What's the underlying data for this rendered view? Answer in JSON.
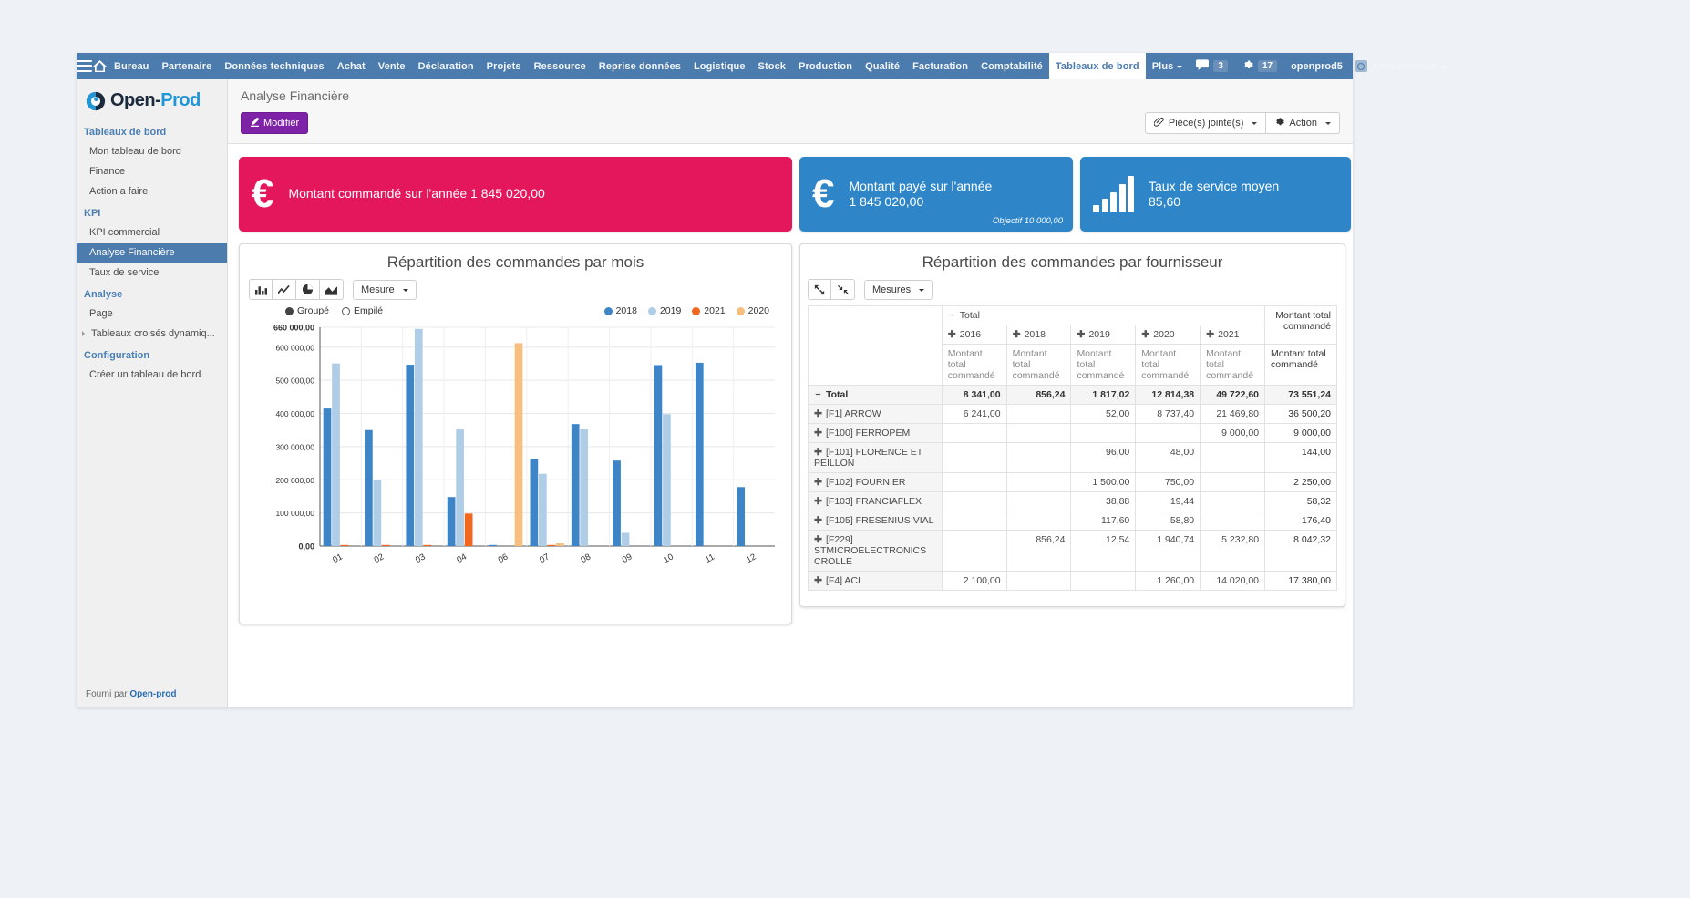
{
  "navbar": {
    "burger_icon": "hamburger-menu-icon",
    "home_icon": "home-icon",
    "items": [
      {
        "label": "Bureau",
        "active": false
      },
      {
        "label": "Partenaire",
        "active": false
      },
      {
        "label": "Données techniques",
        "active": false
      },
      {
        "label": "Achat",
        "active": false
      },
      {
        "label": "Vente",
        "active": false
      },
      {
        "label": "Déclaration",
        "active": false
      },
      {
        "label": "Projets",
        "active": false
      },
      {
        "label": "Ressource",
        "active": false
      },
      {
        "label": "Reprise données",
        "active": false
      },
      {
        "label": "Logistique",
        "active": false
      },
      {
        "label": "Stock",
        "active": false
      },
      {
        "label": "Production",
        "active": false
      },
      {
        "label": "Qualité",
        "active": false
      },
      {
        "label": "Facturation",
        "active": false
      },
      {
        "label": "Comptabilité",
        "active": false
      },
      {
        "label": "Tableaux de bord",
        "active": true
      },
      {
        "label": "Plus",
        "active": false,
        "caret": true
      }
    ],
    "messages_count": "3",
    "activities_count": "17",
    "database": "openprod5",
    "user": "Administrator"
  },
  "sidebar": {
    "brand": {
      "open": "Open",
      "dash": "-",
      "prod": "Prod"
    },
    "groups": [
      {
        "title": "Tableaux de bord",
        "items": [
          {
            "label": "Mon tableau de bord",
            "active": false,
            "expandable": false
          },
          {
            "label": "Finance",
            "active": false,
            "expandable": false
          },
          {
            "label": "Action a faire",
            "active": false,
            "expandable": false
          }
        ]
      },
      {
        "title": "KPI",
        "items": [
          {
            "label": "KPI commercial",
            "active": false,
            "expandable": false
          },
          {
            "label": "Analyse Financière",
            "active": true,
            "expandable": false
          },
          {
            "label": "Taux de service",
            "active": false,
            "expandable": false
          }
        ]
      },
      {
        "title": "Analyse",
        "items": [
          {
            "label": "Page",
            "active": false,
            "expandable": false
          },
          {
            "label": "Tableaux croisés dynamiq...",
            "active": false,
            "expandable": true
          }
        ]
      },
      {
        "title": "Configuration",
        "items": [
          {
            "label": "Créer un tableau de bord",
            "active": false,
            "expandable": false
          }
        ]
      }
    ],
    "footer_prefix": "Fourni par ",
    "footer_brand": "Open-prod"
  },
  "page": {
    "title": "Analyse Financière",
    "edit_button": "Modifier",
    "edit_icon": "pencil-square-icon",
    "attachments_button": "Pièce(s) jointe(s)",
    "attachments_icon": "paperclip-icon",
    "action_button": "Action",
    "action_icon": "gear-icon"
  },
  "kpis": [
    {
      "name": "montant-commande",
      "icon": "euro-icon",
      "glyph": "€",
      "text": "Montant commandé sur l'année 1 845 020,00",
      "color": "#e4175c",
      "goal": null
    },
    {
      "name": "montant-paye",
      "icon": "euro-icon",
      "glyph": "€",
      "line1": "Montant payé sur l'année",
      "line2": "1 845 020,00",
      "color": "#2e86c8",
      "goal": "Objectif 10 000,00"
    },
    {
      "name": "taux-de-service",
      "icon": "bar-chart-icon",
      "line1": "Taux de service moyen",
      "line2": "85,60",
      "color": "#2e86c8",
      "goal": null
    }
  ],
  "chart_panel": {
    "title": "Répartition des commandes par mois",
    "view_buttons": [
      {
        "name": "bar-chart-icon",
        "label": "bar"
      },
      {
        "name": "line-chart-icon",
        "label": "line"
      },
      {
        "name": "pie-chart-icon",
        "label": "pie"
      },
      {
        "name": "area-chart-icon",
        "label": "area"
      }
    ],
    "measure_dropdown": "Mesure",
    "mode_options": [
      {
        "label": "Groupé",
        "selected": true
      },
      {
        "label": "Empilé",
        "selected": false
      }
    ]
  },
  "chart_data": {
    "type": "bar",
    "title": "Répartition des commandes par mois",
    "xlabel": "",
    "ylabel": "",
    "grid": true,
    "legend_position": "top-right",
    "ylim": [
      0,
      660000
    ],
    "yticks": [
      "0,00",
      "100 000,00",
      "200 000,00",
      "300 000,00",
      "400 000,00",
      "500 000,00",
      "600 000,00",
      "660 000,00"
    ],
    "ytick_values": [
      0,
      100000,
      200000,
      300000,
      400000,
      500000,
      600000,
      660000
    ],
    "categories": [
      "01",
      "02",
      "03",
      "04",
      "06",
      "07",
      "08",
      "09",
      "10",
      "11",
      "12"
    ],
    "series": [
      {
        "name": "2018",
        "color": "#3d85c6",
        "values": [
          415000,
          350000,
          547000,
          148000,
          3000,
          262000,
          368000,
          258000,
          546000,
          553000,
          178000
        ]
      },
      {
        "name": "2019",
        "color": "#b0cde8",
        "values": [
          551000,
          200000,
          655000,
          352000,
          0,
          218000,
          352000,
          40000,
          398000,
          0,
          0
        ]
      },
      {
        "name": "2021",
        "color": "#f2671f",
        "values": [
          1500,
          1500,
          1500,
          98000,
          0,
          1500,
          0,
          0,
          0,
          0,
          0
        ]
      },
      {
        "name": "2020",
        "color": "#f7be7e",
        "values": [
          0,
          0,
          0,
          0,
          612000,
          8000,
          0,
          0,
          0,
          0,
          0
        ]
      }
    ]
  },
  "pivot_panel": {
    "title": "Répartition des commandes par fournisseur",
    "expand_icon": "expand-arrows-icon",
    "collapse_icon": "compress-arrows-icon",
    "measures_dropdown": "Mesures"
  },
  "pivot": {
    "col_group_label": "Total",
    "col_years": [
      "2016",
      "2018",
      "2019",
      "2020",
      "2021"
    ],
    "measure_label": "Montant total commandé",
    "grand_total_header": "Montant total commandé",
    "rows": [
      {
        "label": "Total",
        "type": "total",
        "toggle": "minus",
        "values": [
          "8 341,00",
          "856,24",
          "1 817,02",
          "12 814,38",
          "49 722,60"
        ],
        "total": "73 551,24"
      },
      {
        "label": "[F1] ARROW",
        "type": "data",
        "toggle": "plus",
        "values": [
          "6 241,00",
          "",
          "52,00",
          "8 737,40",
          "21 469,80"
        ],
        "total": "36 500,20"
      },
      {
        "label": "[F100] FERROPEM",
        "type": "data",
        "toggle": "plus",
        "values": [
          "",
          "",
          "",
          "",
          "9 000,00"
        ],
        "total": "9 000,00"
      },
      {
        "label": "[F101] FLORENCE ET PEILLON",
        "type": "data",
        "toggle": "plus",
        "values": [
          "",
          "",
          "96,00",
          "48,00",
          ""
        ],
        "total": "144,00"
      },
      {
        "label": "[F102] FOURNIER",
        "type": "data",
        "toggle": "plus",
        "values": [
          "",
          "",
          "1 500,00",
          "750,00",
          ""
        ],
        "total": "2 250,00"
      },
      {
        "label": "[F103] FRANCIAFLEX",
        "type": "data",
        "toggle": "plus",
        "values": [
          "",
          "",
          "38,88",
          "19,44",
          ""
        ],
        "total": "58,32"
      },
      {
        "label": "[F105] FRESENIUS VIAL",
        "type": "data",
        "toggle": "plus",
        "values": [
          "",
          "",
          "117,60",
          "58,80",
          ""
        ],
        "total": "176,40"
      },
      {
        "label": "[F229] STMICROELECTRONICS CROLLE",
        "type": "data",
        "toggle": "plus",
        "values": [
          "",
          "856,24",
          "12,54",
          "1 940,74",
          "5 232,80"
        ],
        "total": "8 042,32"
      },
      {
        "label": "[F4] ACI",
        "type": "data",
        "toggle": "plus",
        "values": [
          "2 100,00",
          "",
          "",
          "1 260,00",
          "14 020,00"
        ],
        "total": "17 380,00"
      }
    ]
  }
}
